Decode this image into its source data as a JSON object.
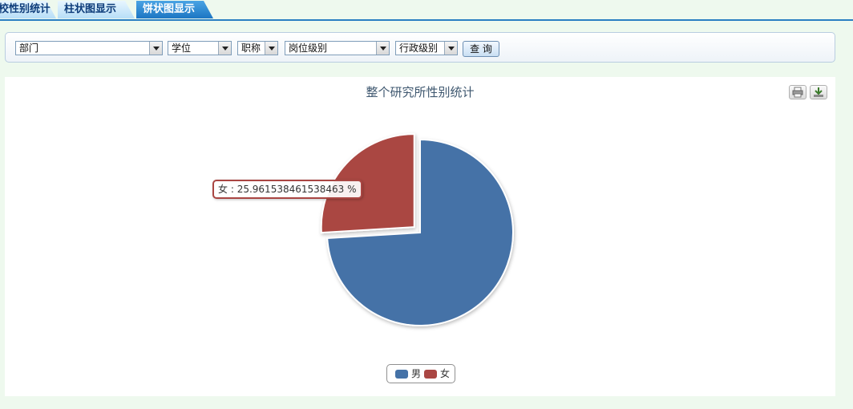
{
  "tabs": [
    "校性别统计",
    "柱状图显示",
    "饼状图显示"
  ],
  "filters": {
    "department": "部门",
    "degree": "学位",
    "title": "职称",
    "post_level": "岗位级别",
    "admin_level": "行政级别",
    "query_button": "查 询"
  },
  "toolbar": {
    "print_icon": "print-icon",
    "export_icon": "download-icon"
  },
  "colors": {
    "male": "#4572a7",
    "female": "#aa4643",
    "tab_active": "#1d76c3"
  },
  "chart_data": {
    "type": "pie",
    "title": "整个研究所性别统计",
    "slices": [
      {
        "name": "男",
        "value": 74.03846153846153
      },
      {
        "name": "女",
        "value": 25.961538461538463
      }
    ],
    "tooltip": {
      "label": "女",
      "text": "25.961538461538463 %"
    },
    "legend": [
      "男",
      "女"
    ],
    "legend_position": "bottom-center"
  }
}
